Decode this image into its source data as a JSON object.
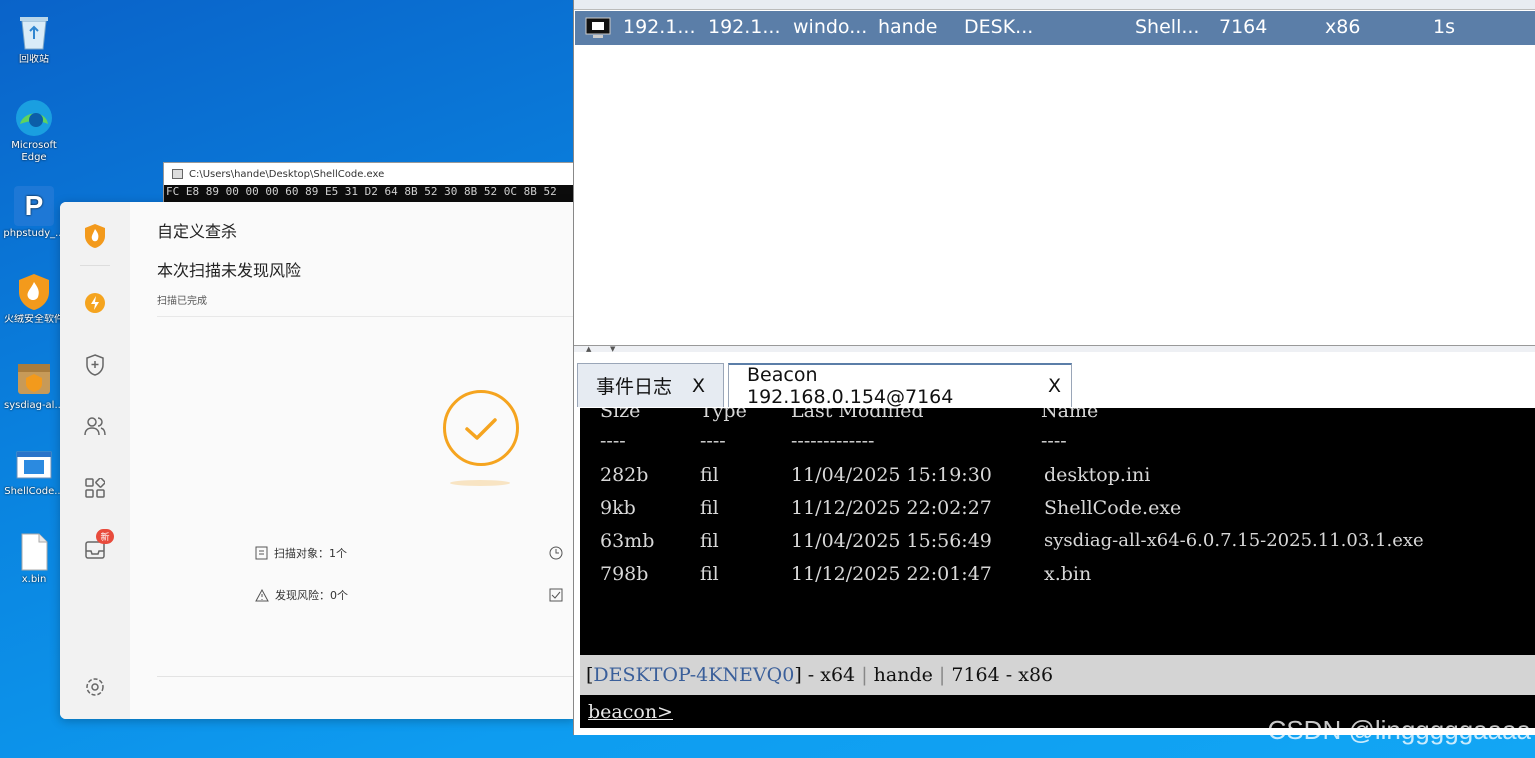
{
  "desktop": {
    "icons": [
      {
        "label": "回收站"
      },
      {
        "label": "Microsoft Edge",
        "label1": "Microsoft",
        "label2": "Edge"
      },
      {
        "label": "phpstudy_..."
      },
      {
        "label": "火绒安全软件"
      },
      {
        "label": "sysdiag-al..."
      },
      {
        "label": "ShellCode..."
      },
      {
        "label": "x.bin"
      }
    ]
  },
  "cmd_window": {
    "title": "C:\\Users\\hande\\Desktop\\ShellCode.exe",
    "output": "FC E8 89 00 00 00 60 89 E5 31 D2 64 8B 52 30 8B 52 0C 8B 52"
  },
  "security_app": {
    "title": "自定义查杀",
    "result": "本次扫描未发现风险",
    "status": "扫描已完成",
    "badge": "新",
    "stats": {
      "scan_objects": "扫描对象：1个",
      "risks_found": "发现风险：0个"
    }
  },
  "cobalt": {
    "session_row": [
      "192.1...",
      "192.1...",
      "windo...",
      "hande",
      "DESK...",
      "",
      "Shell...",
      "7164",
      "x86",
      "1s"
    ],
    "tabs": [
      {
        "label": "事件日志",
        "close": "X"
      },
      {
        "label": "Beacon 192.168.0.154@7164",
        "close": "X"
      }
    ],
    "listing": {
      "header": [
        "Size",
        "Type",
        "Last Modified",
        "Name"
      ],
      "rule": [
        "----",
        "----",
        "-------------",
        "----"
      ],
      "rows": [
        [
          "282b",
          "fil",
          "11/04/2025 15:19:30",
          "desktop.ini"
        ],
        [
          "9kb",
          "fil",
          "11/12/2025 22:02:27",
          "ShellCode.exe"
        ],
        [
          "63mb",
          "fil",
          "11/04/2025 15:56:49",
          "sysdiag-all-x64-6.0.7.15-2025.11.03.1.exe"
        ],
        [
          "798b",
          "fil",
          "11/12/2025 22:01:47",
          "x.bin"
        ]
      ]
    },
    "status": {
      "host": "DESKTOP-4KNEVQ0",
      "arch": "x64",
      "user": "hande",
      "pid_arch": "7164 - x86"
    },
    "prompt": "beacon>"
  },
  "watermark": "CSDN @lingggggaaaa"
}
